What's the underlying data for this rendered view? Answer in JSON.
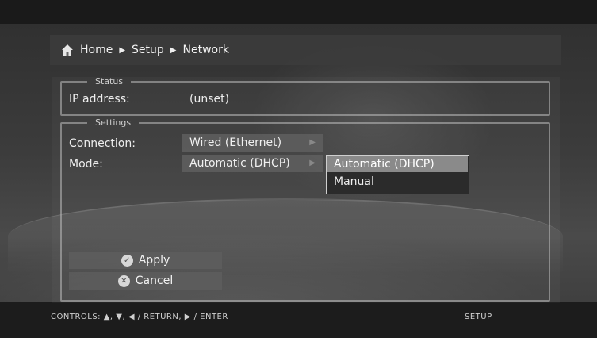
{
  "breadcrumb": {
    "home_icon": "home-icon",
    "items": [
      "Home",
      "Setup",
      "Network"
    ]
  },
  "status": {
    "legend": "Status",
    "ip_label": "IP address:",
    "ip_value": "(unset)"
  },
  "settings": {
    "legend": "Settings",
    "connection_label": "Connection:",
    "connection_value": "Wired (Ethernet)",
    "mode_label": "Mode:",
    "mode_value": "Automatic (DHCP)",
    "mode_options": [
      "Automatic (DHCP)",
      "Manual"
    ]
  },
  "buttons": {
    "apply": "Apply",
    "cancel": "Cancel"
  },
  "footer": {
    "controls": "CONTROLS:  ▲, ▼, ◀ / RETURN, ▶ / ENTER",
    "section": "SETUP"
  }
}
